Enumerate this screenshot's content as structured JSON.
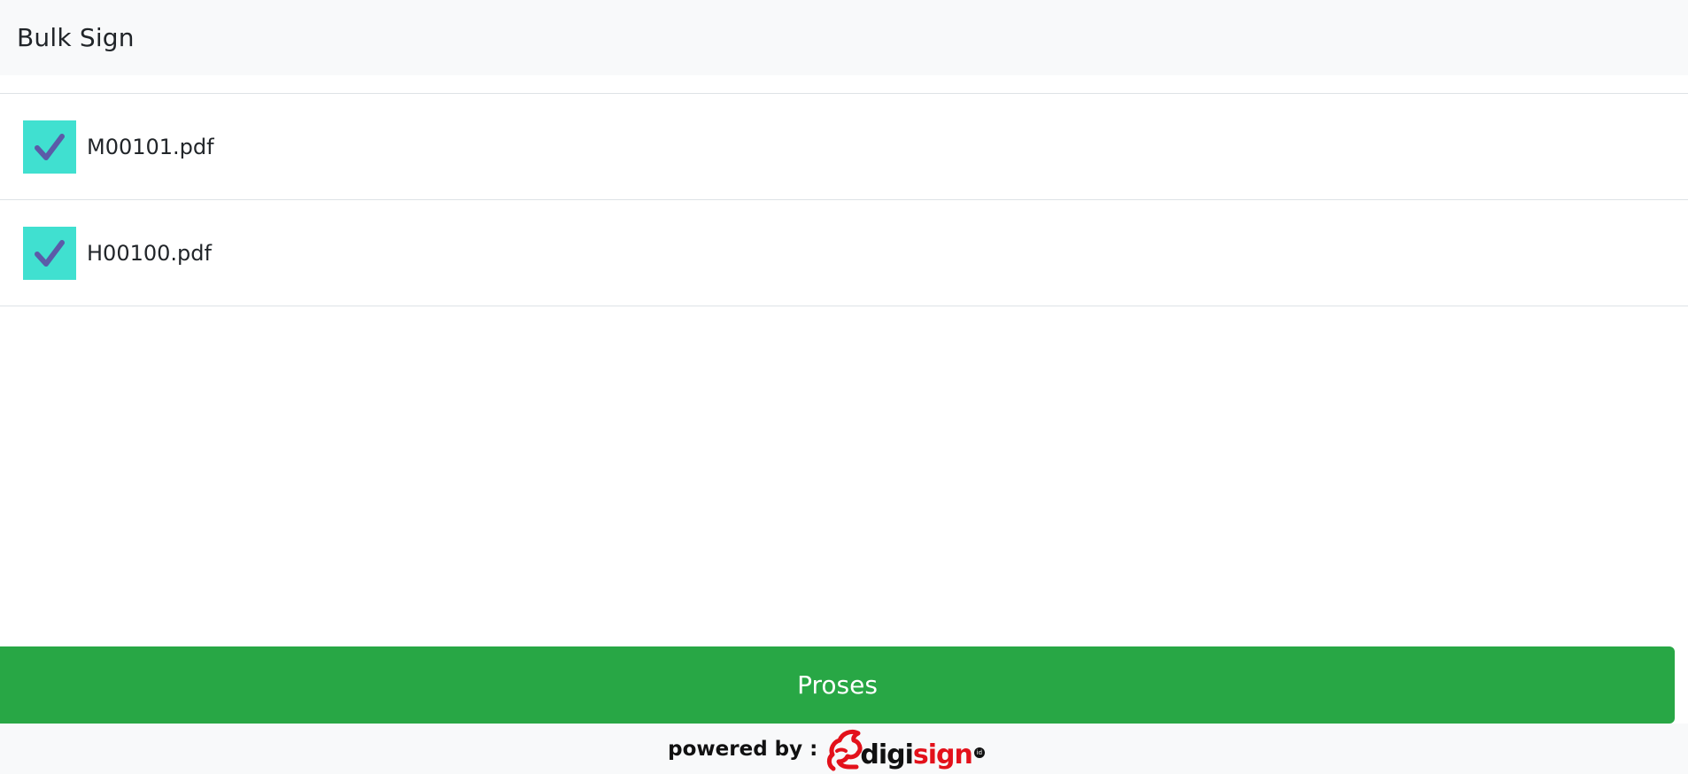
{
  "header": {
    "title": "Bulk Sign"
  },
  "files": [
    {
      "name": "M00101.pdf",
      "checked": true
    },
    {
      "name": "H00100.pdf",
      "checked": true
    }
  ],
  "actions": {
    "process_label": "Proses"
  },
  "footer": {
    "powered_by": "powered by :",
    "logo_text_dark": "digi",
    "logo_text_red": "sign",
    "logo_badge": "id"
  },
  "icons": {
    "checkbox": "checkmark-icon",
    "logo": "digisign-logo-icon"
  },
  "colors": {
    "header_bg": "#f8f9fa",
    "checkbox_bg": "#40e0d0",
    "checkmark": "#5b5ba8",
    "process_button": "#28a745",
    "logo_red": "#e3111b"
  }
}
